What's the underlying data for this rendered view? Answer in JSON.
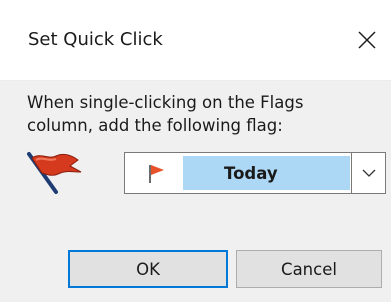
{
  "dialog": {
    "title": "Set Quick Click",
    "prompt_line1": "When single-clicking on the Flags",
    "prompt_line2": "column, add the following flag:",
    "flag_select": {
      "selected_value": "Today",
      "icon": "red-flag-icon"
    },
    "ok_label": "OK",
    "cancel_label": "Cancel"
  },
  "icons": {
    "close": "close-icon",
    "flag_large": "red-flag-icon",
    "dropdown": "chevron-down-icon"
  },
  "colors": {
    "flag_red": "#d63a1e",
    "flag_pole": "#1f3b73",
    "selection_highlight": "#add8f5",
    "focus_border": "#0078d7",
    "body_bg": "#f0f0f0"
  }
}
